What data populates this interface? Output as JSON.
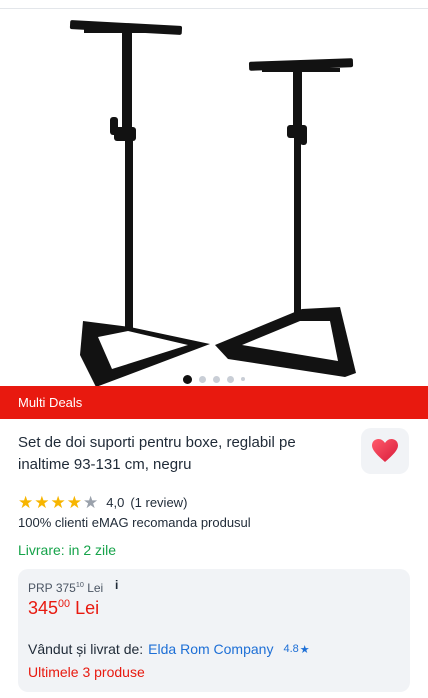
{
  "gallery": {
    "image_alt": "speaker stands",
    "dots": 5,
    "active_dot": 1
  },
  "promo": {
    "label": "Multi Deals",
    "color": "#e8190f"
  },
  "product": {
    "title": "Set de doi suporti pentru boxe, reglabil pe inaltime 93-131 cm, negru",
    "favorite_icon": "heart-icon",
    "rating": {
      "stars_filled": 4,
      "stars_total": 5,
      "value": "4,0",
      "reviews": "(1 review)"
    },
    "recommend": "100% clienti eMAG recomanda produsul",
    "delivery": "Livrare: in 2 zile"
  },
  "pricing": {
    "prp_label": "PRP",
    "prp_int": "375",
    "prp_dec": "10",
    "prp_currency": "Lei",
    "info_icon": "i",
    "price_int": "345",
    "price_dec": "00",
    "price_currency": "Lei"
  },
  "seller": {
    "label": "Vândut și livrat de:",
    "name": "Elda Rom Company",
    "score": "4.8",
    "score_star": "★"
  },
  "stock": "Ultimele 3 produse"
}
